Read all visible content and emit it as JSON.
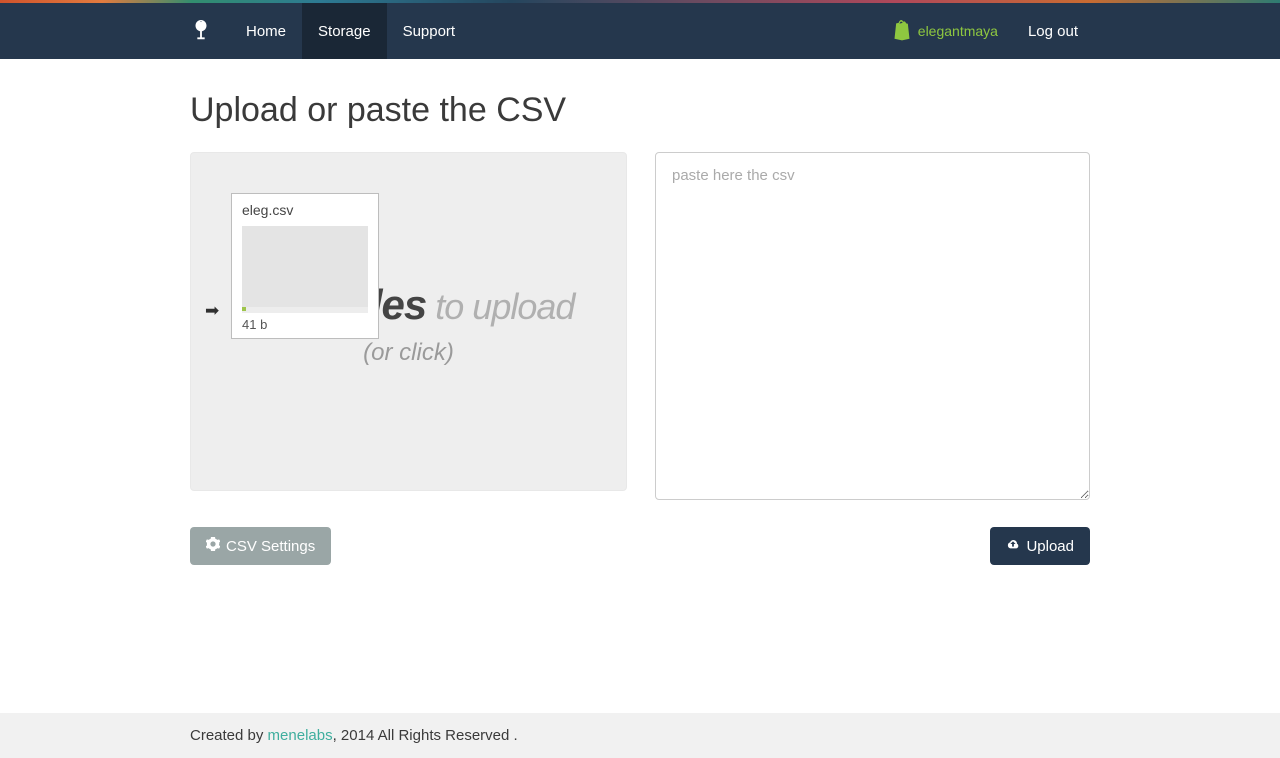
{
  "nav": {
    "items": [
      {
        "label": "Home"
      },
      {
        "label": "Storage"
      },
      {
        "label": "Support"
      }
    ],
    "store_name": "elegantmaya",
    "logout_label": "Log out"
  },
  "page": {
    "title": "Upload or paste the CSV"
  },
  "upload": {
    "drop_bold": "Drop files",
    "drop_tail": " to upload",
    "drop_sub": "(or click)",
    "file": {
      "name": "eleg.csv",
      "size": "41 b"
    }
  },
  "paste": {
    "placeholder": "paste here the csv",
    "value": ""
  },
  "buttons": {
    "csv_settings": "CSV Settings",
    "upload": "Upload"
  },
  "footer": {
    "prefix": "Created by ",
    "link_text": "menelabs",
    "suffix": ", 2014 All Rights Reserved ."
  }
}
